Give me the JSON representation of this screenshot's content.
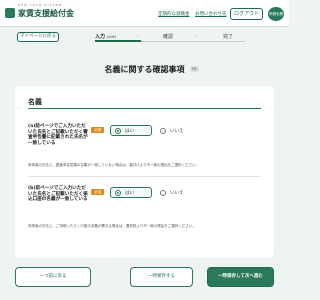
{
  "header": {
    "logo_sub": "NEW  LOAN  SYSTEM",
    "logo": "家賃支援給付金",
    "link_help": "定期的な退職金",
    "link_faq": "お問い合わせ先",
    "login": "ログアウト",
    "menu": "申請を開く"
  },
  "nav": {
    "mypage": "マイページに戻る",
    "steps": [
      {
        "label": "入力",
        "sub": "(4/6)"
      },
      {
        "label": "確認",
        "sub": ""
      },
      {
        "label": "完了",
        "sub": ""
      }
    ]
  },
  "page": {
    "title": "名義に関する確認事項",
    "badge": "F4"
  },
  "card": {
    "title": "名義",
    "questions": [
      {
        "label": "(a)前ページでご入力いただいた氏名とご記載いただく審査申告書に記載された氏名が一致している",
        "required": "必須",
        "yes": "はい",
        "no": "いいえ",
        "note": "申請者の氏名と、審査申告書類の名義が一致していない場合は、裏付けより不一致の理由をご選択ください。"
      },
      {
        "label": "(b)前ページでご入力いただいた氏名とご記載いただく振込口座の名義が一致している",
        "required": "必須",
        "yes": "はい",
        "no": "いいえ",
        "note": "申請者の氏名と、ご申請いただく口座の名義が異なる場合は、選択肢より不一致の理由をご選択ください。"
      }
    ]
  },
  "footer": {
    "back": "一つ前に戻る",
    "save": "一時保存する",
    "next": "一時保存して次へ進む"
  },
  "colors": {
    "brand": "#2a7a5a",
    "required": "#e08a1b",
    "background": "#eef4ef"
  }
}
